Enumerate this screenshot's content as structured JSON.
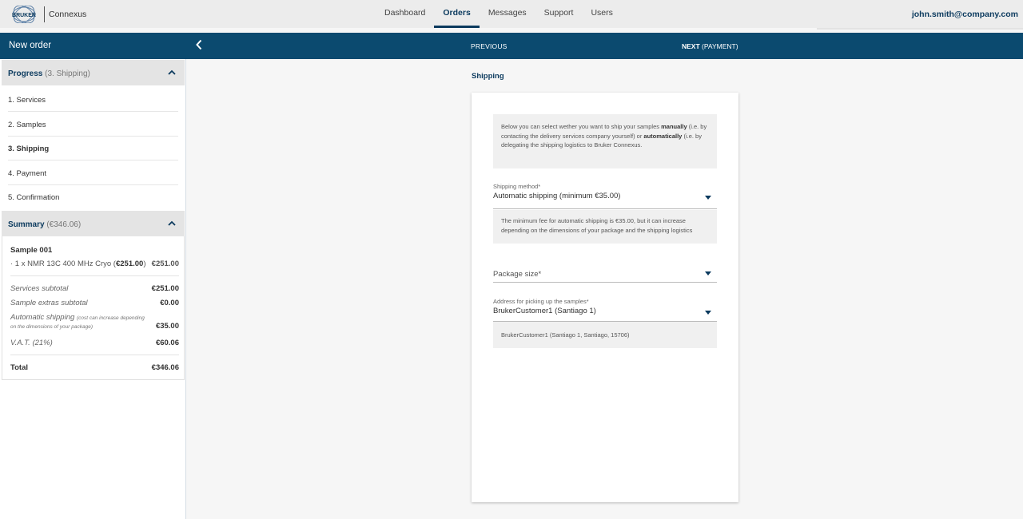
{
  "header": {
    "brand_mark": "BRUKER",
    "brand_name": "Connexus",
    "nav": [
      "Dashboard",
      "Orders",
      "Messages",
      "Support",
      "Users"
    ],
    "active_nav": "Orders",
    "user_email": "john.smith@company.com"
  },
  "toolbar": {
    "title": "New order",
    "back_icon": "chevron-left-icon",
    "previous_label": "PREVIOUS",
    "next_label_bold": "NEXT",
    "next_label_rest": " (PAYMENT)"
  },
  "progress": {
    "title": "Progress",
    "subtitle": " (3. Shipping)",
    "steps": [
      "1. Services",
      "2. Samples",
      "3. Shipping",
      "4. Payment",
      "5. Confirmation"
    ],
    "active_step": "3. Shipping"
  },
  "summary": {
    "title": "Summary",
    "subtitle": " (€346.06)",
    "sample_name": "Sample 001",
    "sample_item_prefix": "· 1 x NMR 13C 400 MHz Cryo (",
    "sample_item_price_bold": "€251.00",
    "sample_item_suffix": ")",
    "sample_item_total": "€251.00",
    "services_subtotal_label": "Services subtotal",
    "services_subtotal_value": "€251.00",
    "extras_subtotal_label": "Sample extras subtotal",
    "extras_subtotal_value": "€0.00",
    "shipping_label": "Automatic shipping",
    "shipping_note_1": "(cost can increase depending",
    "shipping_note_2": "on the dimensions of your package)",
    "shipping_value": "€35.00",
    "vat_label": "V.A.T. (21%)",
    "vat_value": "€60.06",
    "total_label": "Total",
    "total_value": "€346.06"
  },
  "shipping": {
    "section_title": "Shipping",
    "info_1": "Below you can select wether you want to ship your samples ",
    "info_manual": "manually",
    "info_2": " (i.e. by contacting the delivery services company yourself) or ",
    "info_auto": "automatically",
    "info_3": " (i.e. by delegating the shipping logistics to Bruker Connexus.",
    "method_label": "Shipping method*",
    "method_value": "Automatic shipping (minimum €35.00)",
    "method_note": "The minimum fee for automatic shipping is €35.00, but it can increase depending on the dimensions of your package and the shipping logistics",
    "package_label": "Package size*",
    "address_label": "Address for picking up the samples*",
    "address_value": "BrukerCustomer1 (Santiago 1)",
    "address_note": "BrukerCustomer1 (Santiago 1, Santiago, 15706)"
  },
  "colors": {
    "brand_blue": "#0b4a6f",
    "accent_text": "#0b3a5e"
  }
}
